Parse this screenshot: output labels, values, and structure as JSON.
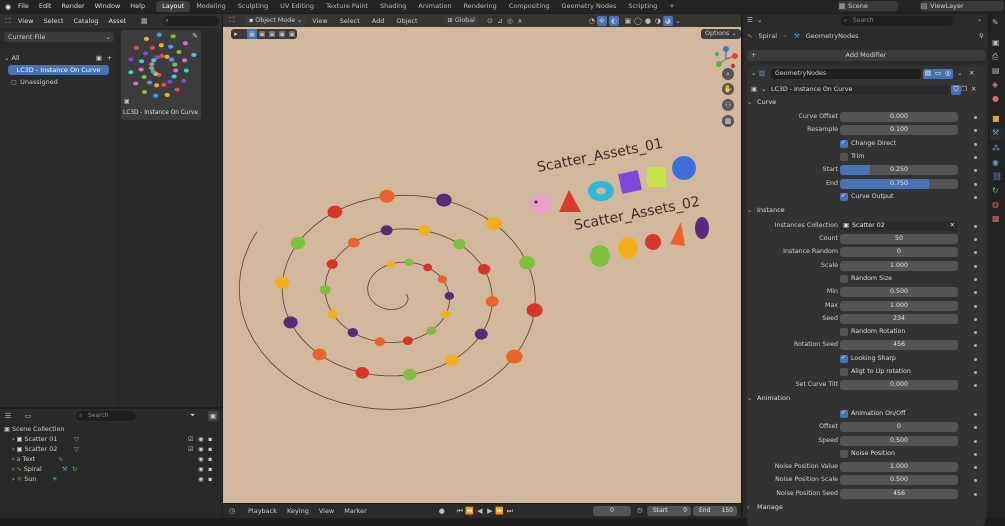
{
  "menu": [
    "File",
    "Edit",
    "Render",
    "Window",
    "Help"
  ],
  "workspaces": [
    "Layout",
    "Modeling",
    "Sculpting",
    "UV Editing",
    "Texture Paint",
    "Shading",
    "Animation",
    "Rendering",
    "Compositing",
    "Geometry Nodes",
    "Scripting"
  ],
  "active_workspace": "Layout",
  "scene": "Scene",
  "view_layer": "ViewLayer",
  "asset_browser": {
    "menu": [
      "View",
      "Select",
      "Catalog",
      "Asset"
    ],
    "library": "Current File",
    "search_placeholder": "",
    "tree": [
      "All",
      "LC3D - Instance On Curve",
      "Unassigned"
    ],
    "thumbnail_label": "LC3D - Instance On Curve"
  },
  "outliner": {
    "search_placeholder": "Search",
    "root": "Scene Collection",
    "items": [
      "Scatter 01",
      "Scatter 02",
      "Text",
      "Spiral",
      "Sun"
    ]
  },
  "viewport": {
    "mode": "Object Mode",
    "menu": [
      "View",
      "Select",
      "Add",
      "Object"
    ],
    "orientation": "Global",
    "options": "Options",
    "text1": "Scatter_Assets_01",
    "text2": "Scatter_Assets_02"
  },
  "timeline": {
    "menu": [
      "Playback",
      "Keying",
      "View",
      "Marker"
    ],
    "frame": "0",
    "start_label": "Start",
    "start": "0",
    "end_label": "End",
    "end": "150"
  },
  "properties": {
    "search_placeholder": "Search",
    "breadcrumb_obj": "Spiral",
    "breadcrumb_mod": "GeometryNodes",
    "add_modifier": "Add Modifier",
    "modifier_name": "GeometryNodes",
    "node_group": "LC3D - Instance On Curve",
    "sections": {
      "curve": "Curve",
      "instance": "Instance",
      "animation": "Animation",
      "manage": "Manage"
    },
    "curve_offset": {
      "label": "Curve Offset",
      "value": "0.000"
    },
    "resample": {
      "label": "Resample",
      "value": "0.100"
    },
    "change_direct": {
      "label": "Change Direct",
      "checked": true
    },
    "trim": {
      "label": "Trim",
      "checked": false
    },
    "start": {
      "label": "Start",
      "value": "0.250",
      "fraction": 0.25
    },
    "end": {
      "label": "End",
      "value": "0.750",
      "fraction": 0.75
    },
    "curve_output": {
      "label": "Curve Output",
      "checked": true
    },
    "instances_collection": {
      "label": "Instances Collection",
      "value": "Scatter 02"
    },
    "count": {
      "label": "Count",
      "value": "50"
    },
    "instance_random": {
      "label": "Instance Random",
      "value": "0"
    },
    "scale": {
      "label": "Scale",
      "value": "1.000"
    },
    "random_size": {
      "label": "Random Size",
      "checked": false
    },
    "min": {
      "label": "Min",
      "value": "0.500"
    },
    "max": {
      "label": "Max",
      "value": "1.000"
    },
    "seed": {
      "label": "Seed",
      "value": "234"
    },
    "random_rotation": {
      "label": "Random Rotation",
      "checked": false
    },
    "rotation_seed": {
      "label": "Rotation Seed",
      "value": "456"
    },
    "looking_sharp": {
      "label": "Looking Sharp",
      "checked": true
    },
    "align_up": {
      "label": "Aligt to Up rotation",
      "checked": false
    },
    "set_curve_tilt": {
      "label": "Set Curve Tilt",
      "value": "0.000"
    },
    "animation_onoff": {
      "label": "Animation On/Off",
      "checked": true
    },
    "offset": {
      "label": "Offset",
      "value": "0"
    },
    "speed": {
      "label": "Speed",
      "value": "0.500"
    },
    "noise_position": {
      "label": "Noise Position",
      "checked": false
    },
    "noise_position_value": {
      "label": "Noise Position Value",
      "value": "1.000"
    },
    "noise_position_scale": {
      "label": "Noise Position Scale",
      "value": "0.500"
    },
    "noise_position_seed": {
      "label": "Noise Position Seed",
      "value": "456"
    }
  },
  "colors": {
    "accent": "#4772b3",
    "viewport_bg": "#d2b89c",
    "panel": "#2b2b2b"
  }
}
